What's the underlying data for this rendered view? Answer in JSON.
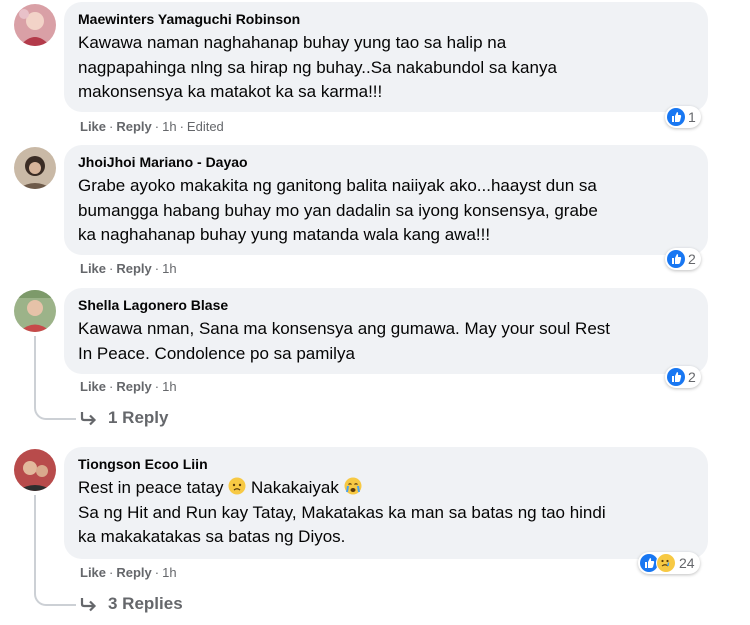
{
  "comments": [
    {
      "author": "Maewinters Yamaguchi Robinson",
      "lines": [
        "Kawawa naman naghahanap buhay yung tao sa halip na",
        "nagpapahinga nlng sa hirap ng buhay..Sa nakabundol sa kanya",
        "makonsensya ka matakot ka sa karma!!!"
      ],
      "like_label": "Like",
      "reply_label": "Reply",
      "time": "1h",
      "edited": "Edited",
      "reaction_count": "1"
    },
    {
      "author": "JhoiJhoi Mariano - Dayao",
      "lines": [
        "Grabe ayoko makakita ng ganitong balita naiiyak ako...haayst dun sa",
        "bumangga habang buhay mo yan dadalin sa iyong konsensya, grabe",
        "ka naghahanap buhay yung matanda wala kang awa!!!"
      ],
      "like_label": "Like",
      "reply_label": "Reply",
      "time": "1h",
      "reaction_count": "2"
    },
    {
      "author": "Shella Lagonero Blase",
      "lines": [
        "Kawawa nman, Sana ma konsensya ang gumawa. May your soul Rest",
        "In Peace. Condolence po sa pamilya"
      ],
      "like_label": "Like",
      "reply_label": "Reply",
      "time": "1h",
      "reaction_count": "2",
      "replies_label": "1 Reply"
    },
    {
      "author": "Tiongson Ecoo Liin",
      "line1_a": "Rest in peace tatay ",
      "line1_b": " Nakakaiyak ",
      "lines": [
        "Sa ng Hit and Run kay Tatay, Makatakas ka man sa batas ng tao hindi",
        "ka makakatakas sa batas ng Diyos."
      ],
      "like_label": "Like",
      "reply_label": "Reply",
      "time": "1h",
      "reaction_count": "24",
      "replies_label": "3 Replies"
    }
  ],
  "separator": "·",
  "colors": {
    "bubble": "#f0f2f5",
    "like_blue": "#1877f2",
    "meta_gray": "#65676b"
  }
}
